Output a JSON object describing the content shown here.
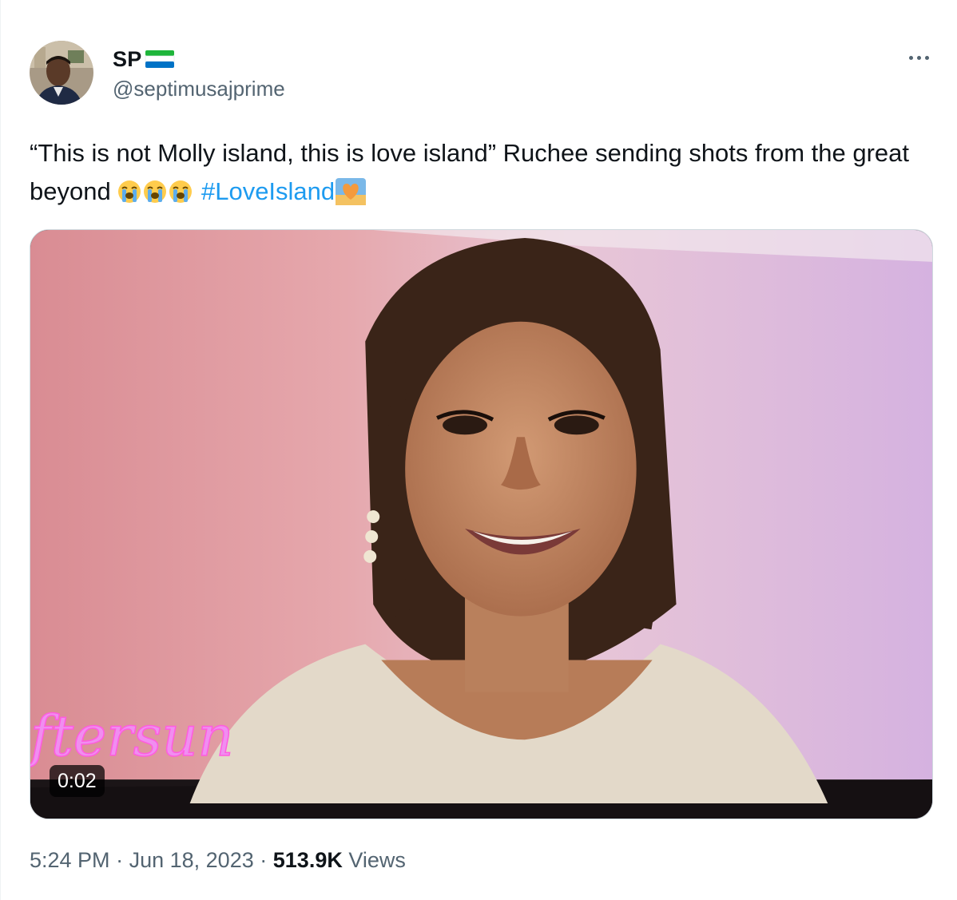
{
  "author": {
    "display_name": "SP",
    "handle": "@septimusajprime",
    "flag_icon": "sierra-leone-flag-icon",
    "flag_colors": [
      "#1eb53a",
      "#ffffff",
      "#0072c6"
    ]
  },
  "tweet": {
    "text": "“This is not Molly island, this is love island” Ruchee sending shots from the great beyond",
    "emojis": [
      "loudly-crying-face-icon",
      "loudly-crying-face-icon",
      "loudly-crying-face-icon"
    ],
    "hashtag": "#LoveIsland",
    "hashtag_emoji": "sunrise-heart-icon"
  },
  "media": {
    "type": "video",
    "duration": "0:02",
    "overlay_text": "ftersun"
  },
  "meta": {
    "time": "5:24 PM",
    "separator": "·",
    "date": "Jun 18, 2023",
    "views_count": "513.9K",
    "views_label": "Views"
  },
  "colors": {
    "link": "#1d9bf0",
    "secondary_text": "#536471",
    "primary_text": "#0f1419"
  }
}
